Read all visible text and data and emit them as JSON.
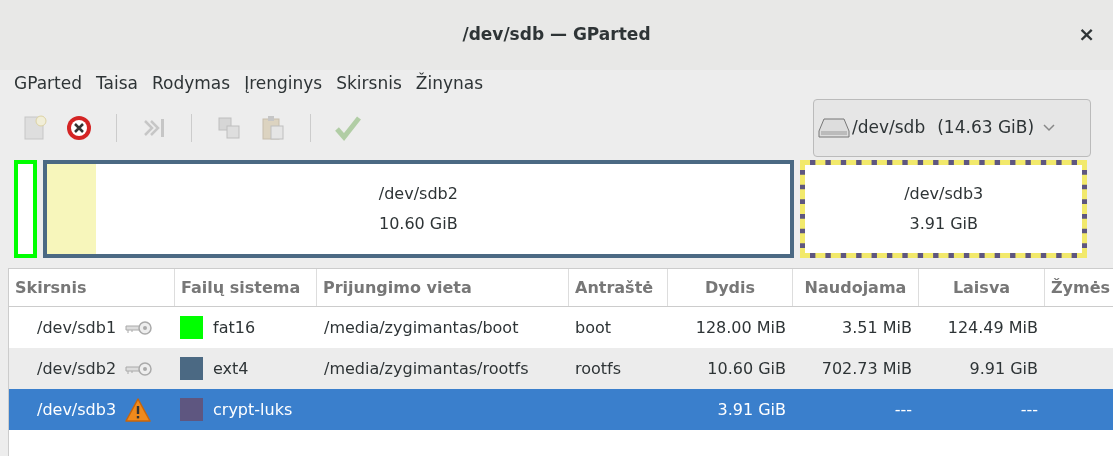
{
  "window": {
    "title": "/dev/sdb — GParted",
    "close": "×"
  },
  "menu": [
    "GParted",
    "Taisa",
    "Rodymas",
    "Įrenginys",
    "Skirsnis",
    "Žinynas"
  ],
  "toolbar": [
    {
      "kind": "new",
      "disabled": true
    },
    {
      "kind": "delete",
      "disabled": false
    },
    {
      "kind": "sep"
    },
    {
      "kind": "resize",
      "disabled": true
    },
    {
      "kind": "sep"
    },
    {
      "kind": "copy",
      "disabled": true
    },
    {
      "kind": "paste",
      "disabled": true
    },
    {
      "kind": "sep"
    },
    {
      "kind": "apply",
      "disabled": true
    }
  ],
  "device": {
    "name": "/dev/sdb",
    "size": "(14.63 GiB)"
  },
  "disk_map": [
    {
      "color": "#00ff00",
      "selected": false
    },
    {
      "name": "/dev/sdb2",
      "size": "10.60 GiB",
      "color": "#4b6983",
      "level": 0.067,
      "selected": false
    },
    {
      "name": "/dev/sdb3",
      "size": "3.91 GiB",
      "color": "#5e5680",
      "selected": true
    }
  ],
  "table": {
    "columns": [
      "Skirsnis",
      "Failų sistema",
      "Prijungimo vieta",
      "Antraštė",
      "Dydis",
      "Naudojama",
      "Laisva",
      "Žymės"
    ],
    "rows": [
      {
        "partition": "/dev/sdb1",
        "kind": "key",
        "color": "#00ff00",
        "filesystem": "fat16",
        "mount": "/media/zygimantas/boot",
        "label": "boot",
        "size": "128.00 MiB",
        "used": "3.51 MiB",
        "free": "124.49 MiB",
        "selected": false
      },
      {
        "partition": "/dev/sdb2",
        "kind": "key",
        "color": "#4b6983",
        "filesystem": "ext4",
        "mount": "/media/zygimantas/rootfs",
        "label": "rootfs",
        "size": "10.60 GiB",
        "used": "702.73 MiB",
        "free": "9.91 GiB",
        "selected": false
      },
      {
        "partition": "/dev/sdb3",
        "kind": "warning",
        "color": "#5e5680",
        "filesystem": "crypt-luks",
        "size": "3.91 GiB",
        "used": "---",
        "free": "---",
        "selected": true
      }
    ]
  }
}
